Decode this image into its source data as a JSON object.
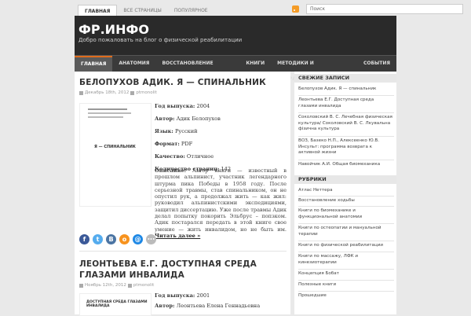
{
  "topnav": {
    "items": [
      "ГЛАВНАЯ",
      "ВСЕ СТРАНИЦЫ",
      "ПОПУЛЯРНОЕ"
    ]
  },
  "search": {
    "placeholder": "Поиск"
  },
  "header": {
    "title": "ФР.ИНФО",
    "subtitle": "Добро пожаловать на блог о физической реабилитации"
  },
  "mainnav": {
    "items": [
      "ГЛАВНАЯ",
      "АНАТОМИЯ",
      "ВОССТАНОВЛЕНИЕ ХОДЬБЫ",
      "КНИГИ",
      "МЕТОДИКИ И НАПРАВЛЕНИЯ",
      "СОБЫТИЯ"
    ]
  },
  "posts": [
    {
      "title": "БЕЛОПУХОВ АДИК. Я — СПИНАЛЬНИК",
      "date": "Декабрь 18th, 2012",
      "author": "ptmonolit",
      "thumb_title": "Я — СПИНАЛЬНИК",
      "fields": [
        {
          "label": "Год выпуска:",
          "value": " 2004"
        },
        {
          "label": "Автор:",
          "value": " Адик Белопухов"
        },
        {
          "label": "Язык:",
          "value": " Русский"
        },
        {
          "label": "Формат:",
          "value": " PDF"
        },
        {
          "label": "Качество:",
          "value": " Отличное"
        },
        {
          "label": "Количество страниц:",
          "value": " 142"
        }
      ],
      "description_label": "Описание:",
      "description": " Автор книги — известный в прошлом альпинист, участник легендарного штурма пика Победы в 1958 году. После серьезной травмы, став спинальником, он не опустил рук, а продолжал жить — как жил: руководил альпинистскими экспедициями, защитил диссертацию. Уже после травмы Адик делал попытку покорить Эльбрус – поп­зком. Адик постарался передать в этой книге свое умение — жить инвалидом, но не быть им.",
      "more": "Читать далее »"
    },
    {
      "title": "ЛЕОНТЬЕВА Е.Г. ДОСТУПНАЯ СРЕДА ГЛАЗАМИ ИНВАЛИДА",
      "date": "Ноябрь 12th, 2012",
      "author": "ptmonolit",
      "thumb_title": "ДОСТУПНАЯ СРЕДА ГЛАЗАМИ ИНВАЛИДА",
      "fields": [
        {
          "label": "Год выпуска:",
          "value": " 2001"
        },
        {
          "label": "Автор:",
          "value": " Леонтьева Елена Геннадьевна"
        }
      ]
    }
  ],
  "share": {
    "icons": [
      {
        "name": "facebook-share-icon",
        "glyph": "f",
        "color": "#3b5998"
      },
      {
        "name": "twitter-share-icon",
        "glyph": "t",
        "color": "#55acee"
      },
      {
        "name": "vk-share-icon",
        "glyph": "В",
        "color": "#4c75a3"
      },
      {
        "name": "odnoklassniki-share-icon",
        "glyph": "о",
        "color": "#f7931e"
      },
      {
        "name": "email-share-icon",
        "glyph": "@",
        "color": "#1e88e5"
      },
      {
        "name": "more-share-icon",
        "glyph": "•••",
        "color": "#bbbbbb"
      }
    ]
  },
  "sidebar": {
    "recent_title": "СВЕЖИЕ ЗАПИСИ",
    "recent": [
      "Белопухов Адик. Я — спинальник",
      "Леонтьева Е.Г. Доступная среда глазами инвалида",
      "Соколовский В. С. Лечебная физическая культура/ Соколовский В. С. Лкувальна фізична культура",
      "ВОЗ, Базеко Н.П., Алексеенко Ю.В. Инсульт: программа возврата к активной жизни",
      "Навойчик А.И. Общая биомеханика"
    ],
    "rubrics_title": "РУБРИКИ",
    "rubrics": [
      "Атлас Неттера",
      "Восстановление ходьбы",
      "Книги по биомеханике и функциональной анатомии",
      "Книги по остеопатии и мануальной терапии",
      "Книги по физической реабилитации",
      "Книги по массажу, ЛФК и кинезиотерапии",
      "Концепция Бобат",
      "Полезные книги",
      "Прошедшие"
    ]
  }
}
